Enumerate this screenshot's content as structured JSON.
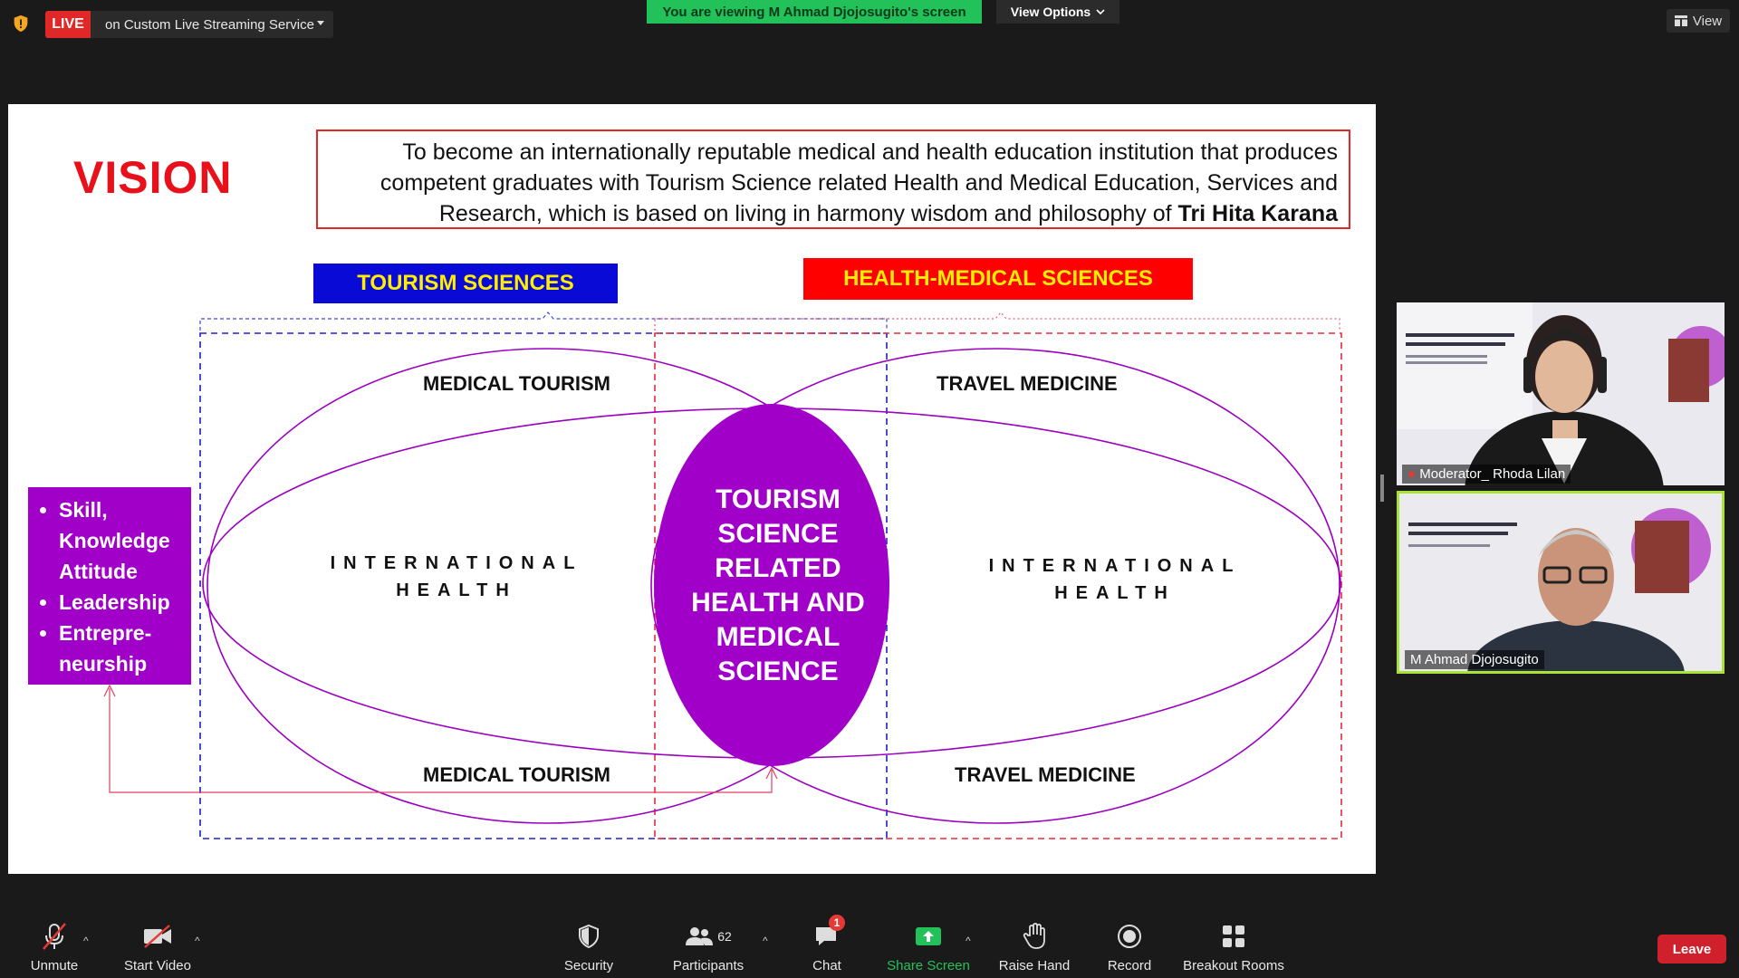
{
  "topbar": {
    "live_label": "LIVE",
    "live_target": "on Custom Live Streaming Service",
    "viewing_banner": "You are viewing M Ahmad Djojosugito's screen",
    "view_options_label": "View Options",
    "view_label": "View"
  },
  "slide": {
    "vision_title": "VISION",
    "vision_text": "To become an internationally reputable medical and health education institution that produces competent graduates with Tourism Science related Health and Medical Education, Services and Research, which is based on living in harmony wisdom and philosophy of",
    "vision_emphasis": "Tri Hita Karana",
    "tourism_label": "TOURISM  SCIENCES",
    "health_label": "HEALTH-MEDICAL SCIENCES",
    "medical_tourism_top": "MEDICAL TOURISM",
    "travel_medicine_top": "TRAVEL MEDICINE",
    "medical_tourism_bottom": "MEDICAL TOURISM",
    "travel_medicine_bottom": "TRAVEL MEDICINE",
    "intl_health_left_1": "INTERNATIONAL",
    "intl_health_left_2": "HEALTH",
    "intl_health_right_1": "INTERNATIONAL",
    "intl_health_right_2": "HEALTH",
    "center_text": [
      "TOURISM",
      "SCIENCE",
      "RELATED",
      "HEALTH AND",
      "MEDICAL",
      "SCIENCE"
    ],
    "skills": [
      "Skill, Knowledge Attitude",
      "Leadership",
      "Entrepre-neurship"
    ],
    "colors": {
      "vision_red": "#e8101a",
      "purple": "#a000c8",
      "blue": "#0a0ad6",
      "yellow": "#ffee00"
    }
  },
  "participants": {
    "p1_name": "Moderator_ Rhoda Lilan",
    "p2_name": "M Ahmad Djojosugito"
  },
  "toolbar": {
    "unmute": "Unmute",
    "start_video": "Start Video",
    "security": "Security",
    "participants": "Participants",
    "participants_count": "62",
    "chat": "Chat",
    "chat_badge": "1",
    "share_screen": "Share Screen",
    "raise_hand": "Raise Hand",
    "record": "Record",
    "breakout": "Breakout Rooms",
    "leave": "Leave"
  }
}
